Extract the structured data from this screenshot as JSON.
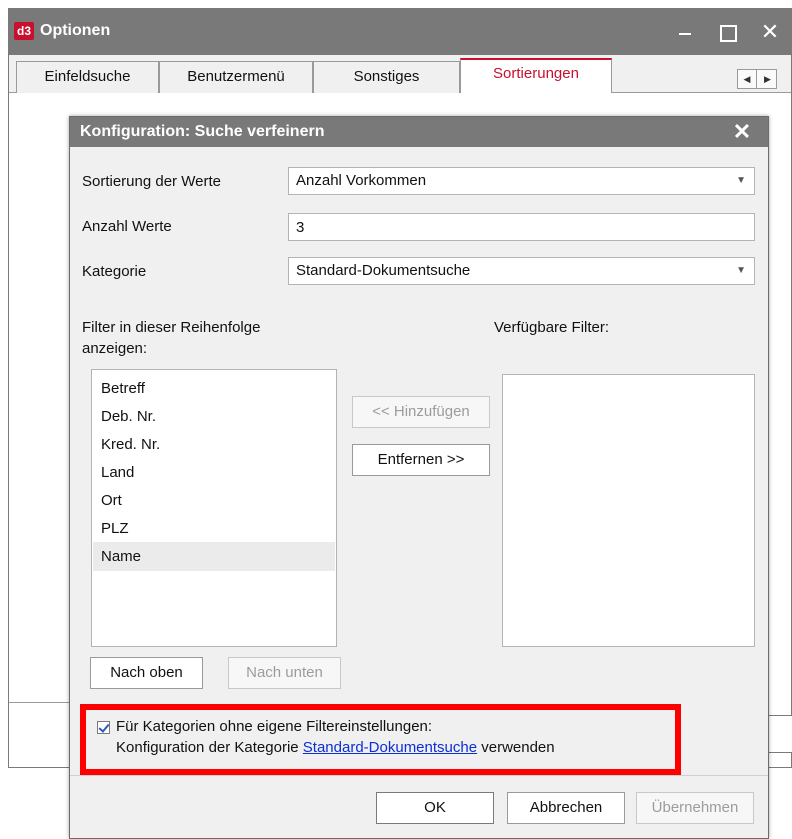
{
  "outer_window": {
    "icon_text": "d3",
    "title": "Optionen",
    "close_glyph": "✕",
    "tabs": [
      {
        "label": "Einfeldsuche"
      },
      {
        "label": "Benutzermenü"
      },
      {
        "label": "Sonstiges"
      },
      {
        "label": "Sortierungen",
        "active": true
      }
    ],
    "tab_scroll_left": "◀",
    "tab_scroll_right": "▶"
  },
  "dialog": {
    "title": "Konfiguration: Suche verfeinern",
    "close_glyph": "✕",
    "sort_label": "Sortierung der Werte",
    "sort_value": "Anzahl Vorkommen",
    "count_label": "Anzahl Werte",
    "count_value": "3",
    "category_label": "Kategorie",
    "category_value": "Standard-Dokumentsuche",
    "dropdown_caret": "▼",
    "filter_order_label_line1": "Filter in dieser Reihenfolge",
    "filter_order_label_line2": "anzeigen:",
    "available_filters_label": "Verfügbare Filter:",
    "filter_list": [
      {
        "label": "Betreff"
      },
      {
        "label": "Deb. Nr."
      },
      {
        "label": "Kred. Nr."
      },
      {
        "label": "Land"
      },
      {
        "label": "Ort"
      },
      {
        "label": "PLZ"
      },
      {
        "label": "Name",
        "selected": true
      }
    ],
    "available_filter_list": [],
    "add_button": "<< Hinzufügen",
    "remove_button": "Entfernen >>",
    "move_up_button": "Nach oben",
    "move_down_button": "Nach unten",
    "checkbox": {
      "checked": true,
      "line1": "Für Kategorien ohne eigene Filtereinstellungen:",
      "line2_prefix": "Konfiguration der Kategorie ",
      "line2_link": "Standard-Dokumentsuche",
      "line2_suffix": " verwenden"
    },
    "ok_button": "OK",
    "cancel_button": "Abbrechen",
    "apply_button": "Übernehmen"
  },
  "colors": {
    "titlebar": "#797979",
    "accent": "#c8102e",
    "highlight_frame": "#ff0000",
    "link": "#0b2fd6"
  }
}
